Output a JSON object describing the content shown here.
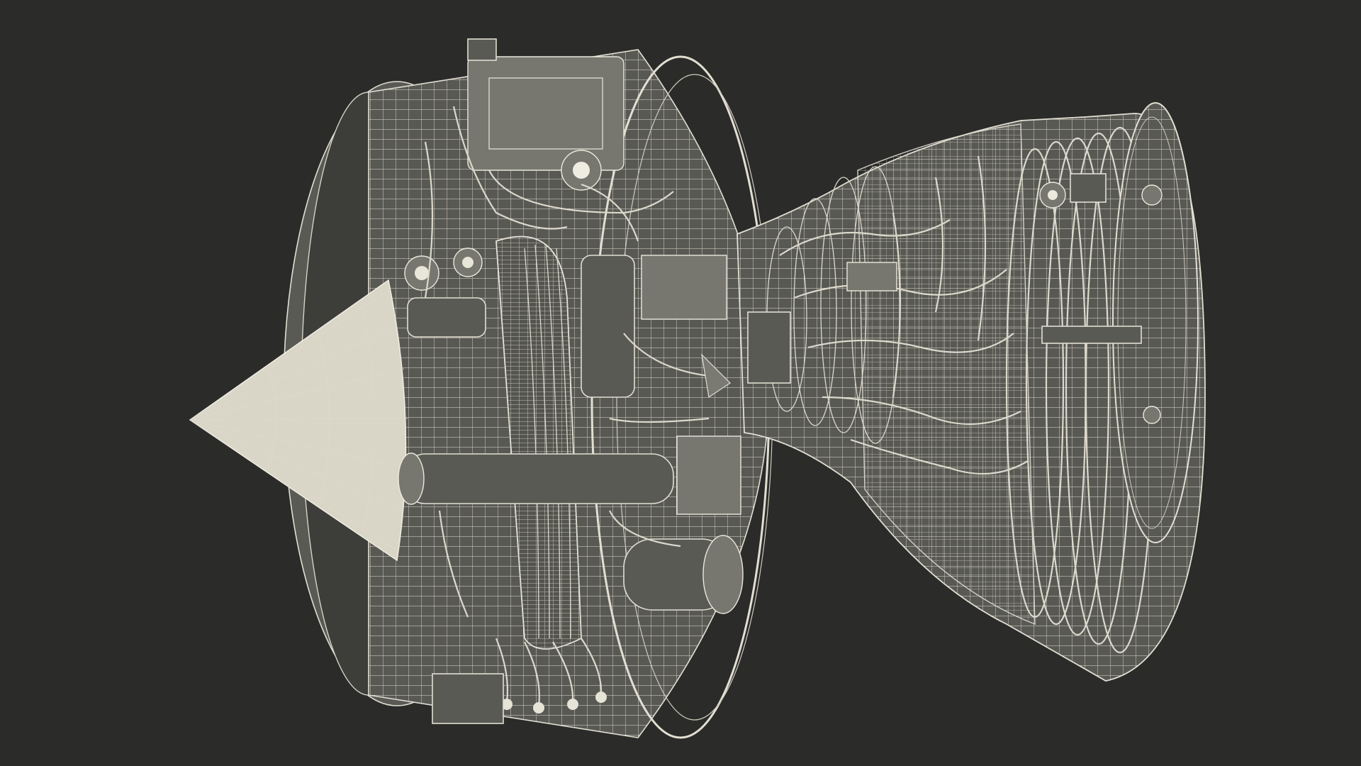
{
  "scene": {
    "subject": "turbofan-engine-wireframe-render",
    "background_color": "#2b2b2a",
    "wire_color": "#dcd9cc",
    "solid_color": "#5a5a55"
  }
}
